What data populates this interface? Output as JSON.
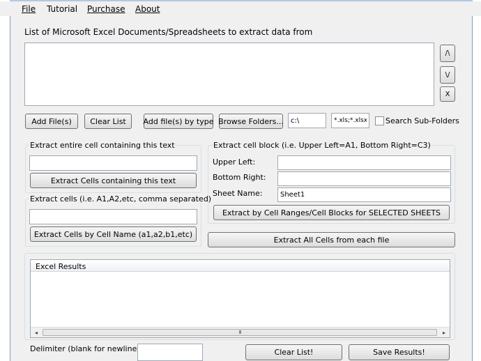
{
  "menu": {
    "file": "File",
    "tutorial": "Tutorial",
    "purchase": "Purchase",
    "about": "About"
  },
  "documents": {
    "list_label": "List of Microsoft Excel Documents/Spreadsheets to extract data from",
    "move_up_label": "/\\",
    "move_down_label": "\\/",
    "remove_label": "X",
    "add_files_label": "Add File(s)",
    "clear_list_label": "Clear List",
    "add_by_type_label": "Add file(s) by type",
    "browse_folders_label": "Browse Folders...",
    "folder_path_value": "c:\\",
    "file_types_value": "*.xls;*.xlsx",
    "search_subfolders_label": "Search Sub-Folders",
    "search_subfolders_checked": false
  },
  "extract_text": {
    "group_label": "Extract entire cell containing this text",
    "input_value": "",
    "button_label": "Extract Cells containing this text"
  },
  "extract_names": {
    "group_label": "Extract cells (i.e. A1,A2,etc, comma separated)",
    "input_value": "",
    "button_label": "Extract Cells by Cell Name (a1,a2,b1,etc)"
  },
  "extract_block": {
    "group_label": "Extract cell block (i.e. Upper Left=A1, Bottom Right=C3)",
    "upper_left_label": "Upper Left:",
    "upper_left_value": "",
    "bottom_right_label": "Bottom Right:",
    "bottom_right_value": "",
    "sheet_name_label": "Sheet Name:",
    "sheet_name_value": "Sheet1",
    "button_label": "Extract by Cell Ranges/Cell Blocks for SELECTED SHEETS"
  },
  "extract_all_label": "Extract All Cells from each file",
  "results": {
    "header_label": "Excel Results",
    "scroll_left": "◂",
    "scroll_right": "▸",
    "thumb_grip": "III"
  },
  "footer": {
    "delimiter_label": "Delimiter (blank for newline)",
    "delimiter_value": "",
    "clear_list_label": "Clear List!",
    "save_results_label": "Save Results!"
  }
}
